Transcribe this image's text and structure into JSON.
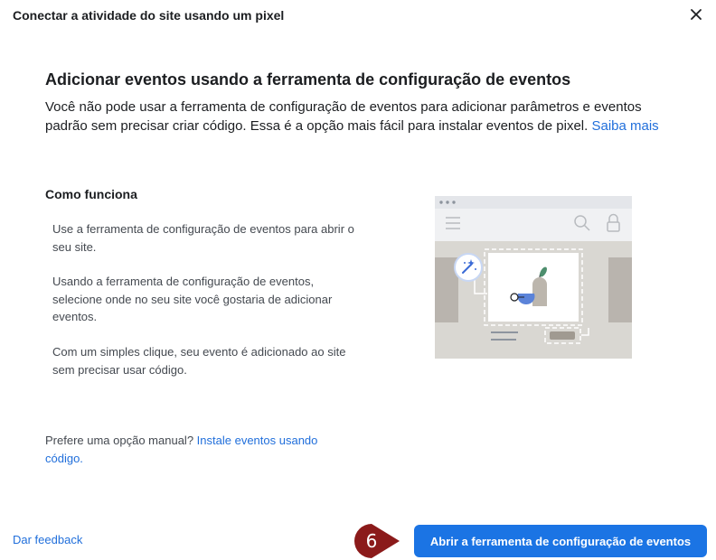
{
  "dialog": {
    "title": "Conectar a atividade do site usando um pixel",
    "close_icon": "close-icon"
  },
  "content": {
    "heading": "Adicionar eventos usando a ferramenta de configuração de eventos",
    "intro_text": "Você não pode usar a ferramenta de configuração de eventos para adicionar parâmetros e eventos padrão sem precisar criar código. Essa é a opção mais fácil para instalar eventos de pixel.",
    "learn_more_link": "Saiba mais",
    "how_it_works": {
      "title": "Como funciona",
      "steps": [
        "Use a ferramenta de configuração de eventos para abrir o seu site.",
        "Usando a ferramenta de configuração de eventos, selecione onde no seu site você gostaria de adicionar eventos.",
        "Com um simples clique, seu evento é adicionado ao site sem precisar usar código."
      ]
    },
    "manual_option": {
      "prefix": "Prefere uma opção manual?",
      "link": "Instale eventos usando código."
    },
    "illustration_icons": [
      "menu-icon",
      "search-icon",
      "lock-icon",
      "magic-wand-icon"
    ]
  },
  "footer": {
    "feedback_link": "Dar feedback",
    "step_marker": "6",
    "primary_button": "Abrir a ferramenta de configuração de eventos"
  },
  "colors": {
    "primary": "#1b74e4",
    "link": "#216fdb",
    "marker": "#8b1a1a"
  }
}
